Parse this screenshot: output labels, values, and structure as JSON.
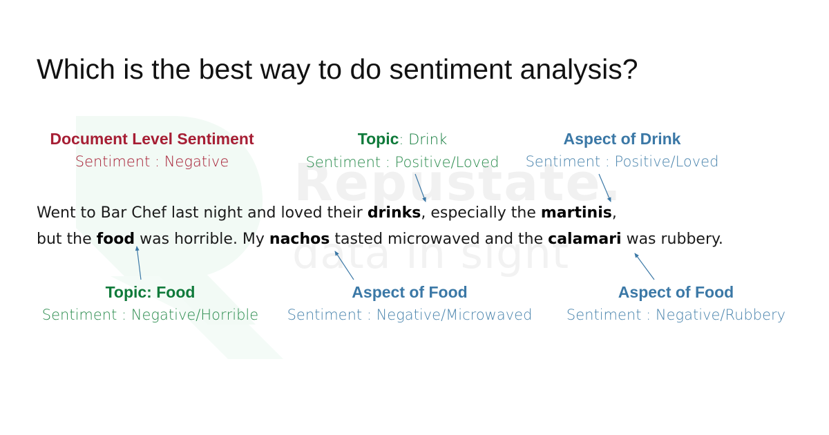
{
  "title": "Which is the best way to do sentiment analysis?",
  "watermark": {
    "brand": "Repustate.",
    "tagline": "data in sight"
  },
  "colors": {
    "document_level": "#a61e34",
    "topic": "#0f7a3a",
    "aspect": "#3b78a6",
    "arrow": "#3b78a6"
  },
  "labels": {
    "document": {
      "heading": "Document Level Sentiment",
      "sentiment": "Sentiment : Negative"
    },
    "topic_drink": {
      "heading_bold": "Topic",
      "heading_rest": ": Drink",
      "sentiment": "Sentiment : Positive/Loved"
    },
    "aspect_drink": {
      "heading": "Aspect of Drink",
      "sentiment": "Sentiment : Positive/Loved"
    },
    "topic_food": {
      "heading": "Topic: Food",
      "sentiment": "Sentiment : Negative/Horrible"
    },
    "aspect_food_nachos": {
      "heading": "Aspect of Food",
      "sentiment": "Sentiment : Negative/Microwaved"
    },
    "aspect_food_calamari": {
      "heading": "Aspect of Food",
      "sentiment": "Sentiment : Negative/Rubbery"
    }
  },
  "sentence": {
    "line1": [
      {
        "text": "Went to Bar Chef last night and loved their ",
        "bold": false
      },
      {
        "text": "drinks",
        "bold": true
      },
      {
        "text": ", especially the ",
        "bold": false
      },
      {
        "text": "martinis",
        "bold": true
      },
      {
        "text": ",",
        "bold": false
      }
    ],
    "line2": [
      {
        "text": "but the ",
        "bold": false
      },
      {
        "text": "food",
        "bold": true
      },
      {
        "text": " was horrible. My ",
        "bold": false
      },
      {
        "text": "nachos",
        "bold": true
      },
      {
        "text": " tasted microwaved and the ",
        "bold": false
      },
      {
        "text": "calamari",
        "bold": true
      },
      {
        "text": " was rubbery.",
        "bold": false
      }
    ]
  }
}
